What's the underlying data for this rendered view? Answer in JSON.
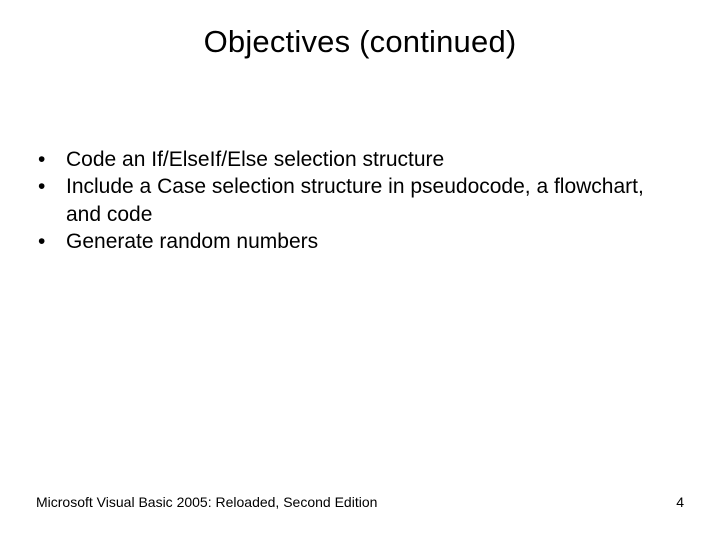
{
  "title": "Objectives (continued)",
  "bullets": [
    "Code an If/ElseIf/Else selection structure",
    "Include a Case selection structure in pseudocode, a flowchart, and code",
    "Generate random numbers"
  ],
  "footer": {
    "source": "Microsoft Visual Basic 2005: Reloaded, Second Edition",
    "page": "4"
  }
}
